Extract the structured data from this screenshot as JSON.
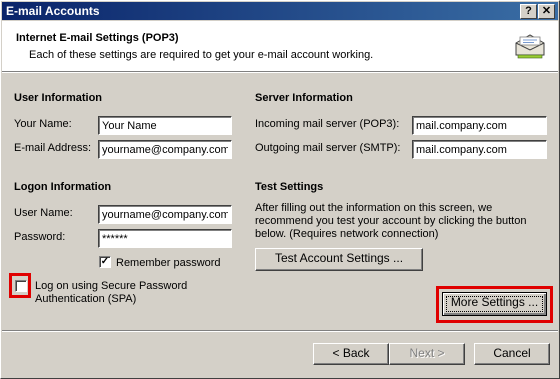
{
  "window": {
    "title": "E-mail Accounts",
    "help_btn": "?",
    "close_btn": "✕"
  },
  "header": {
    "title": "Internet E-mail Settings (POP3)",
    "subtitle": "Each of these settings are required to get your e-mail account working."
  },
  "user_info": {
    "heading": "User Information",
    "name_label": "Your Name:",
    "name_value": "Your Name",
    "email_label": "E-mail Address:",
    "email_value": "yourname@company.com"
  },
  "server_info": {
    "heading": "Server Information",
    "incoming_label": "Incoming mail server (POP3):",
    "incoming_value": "mail.company.com",
    "outgoing_label": "Outgoing mail server (SMTP):",
    "outgoing_value": "mail.company.com"
  },
  "logon_info": {
    "heading": "Logon Information",
    "username_label": "User Name:",
    "username_value": "yourname@company.com",
    "password_label": "Password:",
    "password_value": "******",
    "remember_label": "Remember password",
    "remember_checked": true,
    "spa_label_line1": "Log on using Secure Password",
    "spa_label_line2": "Authentication (SPA)",
    "spa_checked": false
  },
  "test_settings": {
    "heading": "Test Settings",
    "description_line1": "After filling out the information on this screen, we",
    "description_line2": "recommend you test your account by clicking the button",
    "description_line3": "below. (Requires network connection)",
    "test_button": "Test Account Settings ..."
  },
  "more_settings_button": "More Settings ...",
  "footer": {
    "back_button": "< Back",
    "next_button": "Next >",
    "cancel_button": "Cancel"
  },
  "colors": {
    "highlight_box": "#e00000",
    "titlebar_start": "#0a246a",
    "titlebar_end": "#3a6ea5"
  }
}
